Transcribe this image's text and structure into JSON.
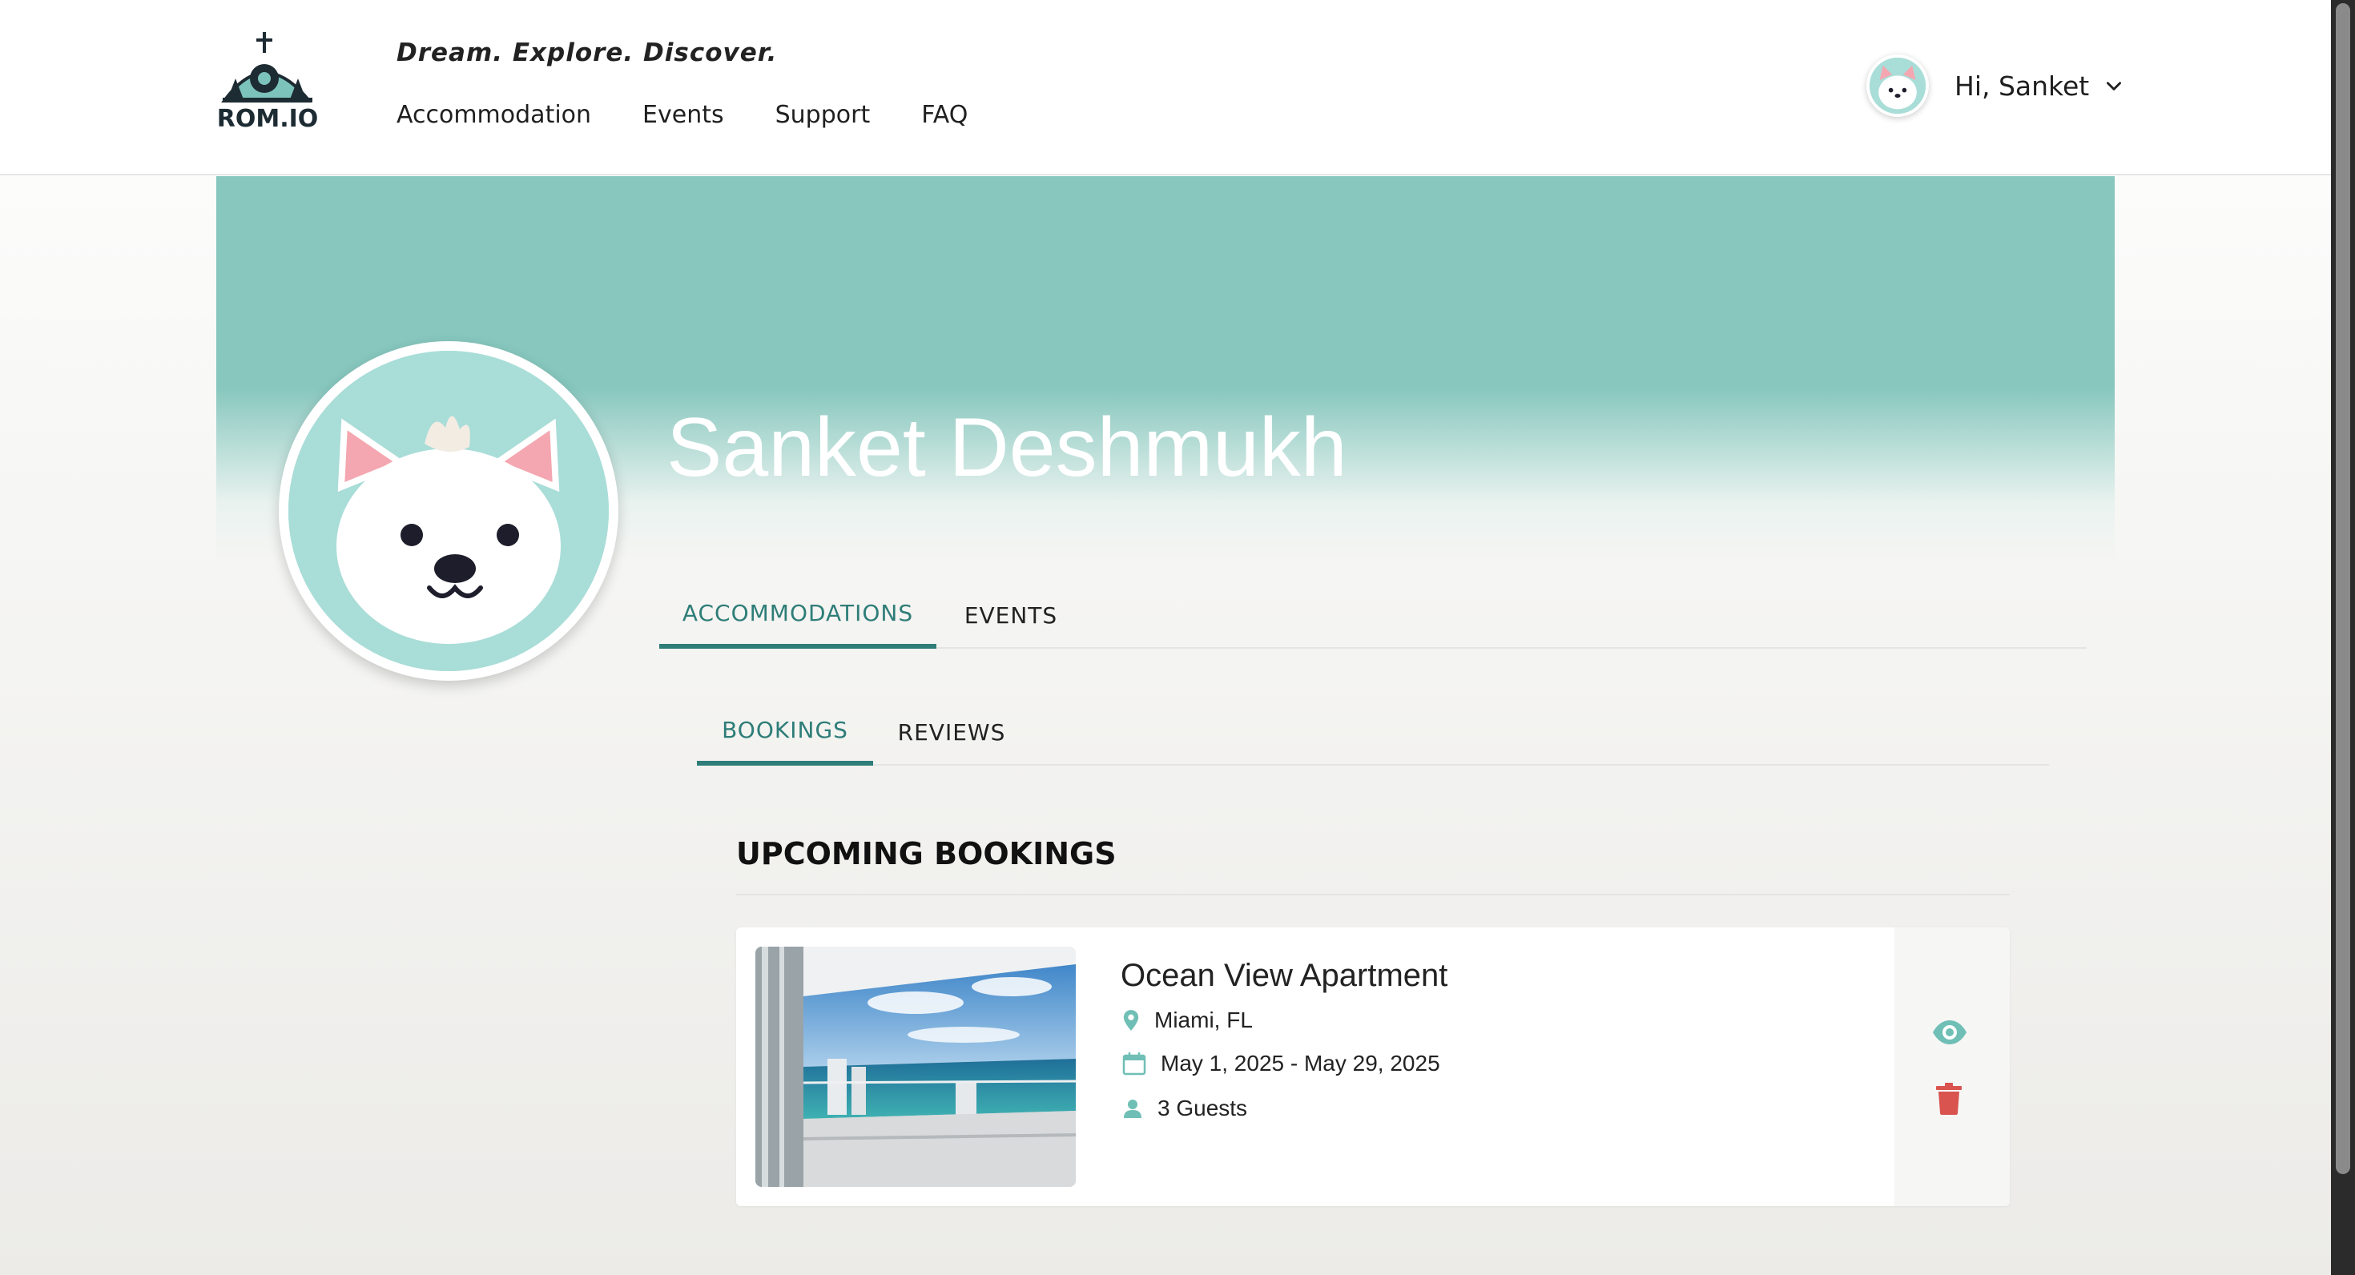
{
  "header": {
    "logo_text": "ROM.IO",
    "tagline": "Dream. Explore. Discover.",
    "nav": [
      {
        "label": "Accommodation"
      },
      {
        "label": "Events"
      },
      {
        "label": "Support"
      },
      {
        "label": "FAQ"
      }
    ],
    "user_greeting": "Hi, Sanket"
  },
  "profile": {
    "name": "Sanket Deshmukh"
  },
  "tabs": {
    "main": [
      {
        "label": "ACCOMMODATIONS",
        "active": true
      },
      {
        "label": "EVENTS",
        "active": false
      }
    ],
    "sub": [
      {
        "label": "BOOKINGS",
        "active": true
      },
      {
        "label": "REVIEWS",
        "active": false
      }
    ]
  },
  "section": {
    "title": "UPCOMING BOOKINGS"
  },
  "bookings": [
    {
      "title": "Ocean View Apartment",
      "location": "Miami, FL",
      "dates": "May 1, 2025 - May 29, 2025",
      "guests": "3 Guests"
    }
  ],
  "colors": {
    "accent": "#2e7d78",
    "banner": "#87c7be",
    "avatar_bg": "#a9ddd8",
    "icon_teal": "#6fbfb6",
    "delete_red": "#d9534f"
  },
  "icons": [
    "map-pin-icon",
    "calendar-icon",
    "person-icon",
    "eye-icon",
    "trash-icon",
    "chevron-down-icon"
  ]
}
